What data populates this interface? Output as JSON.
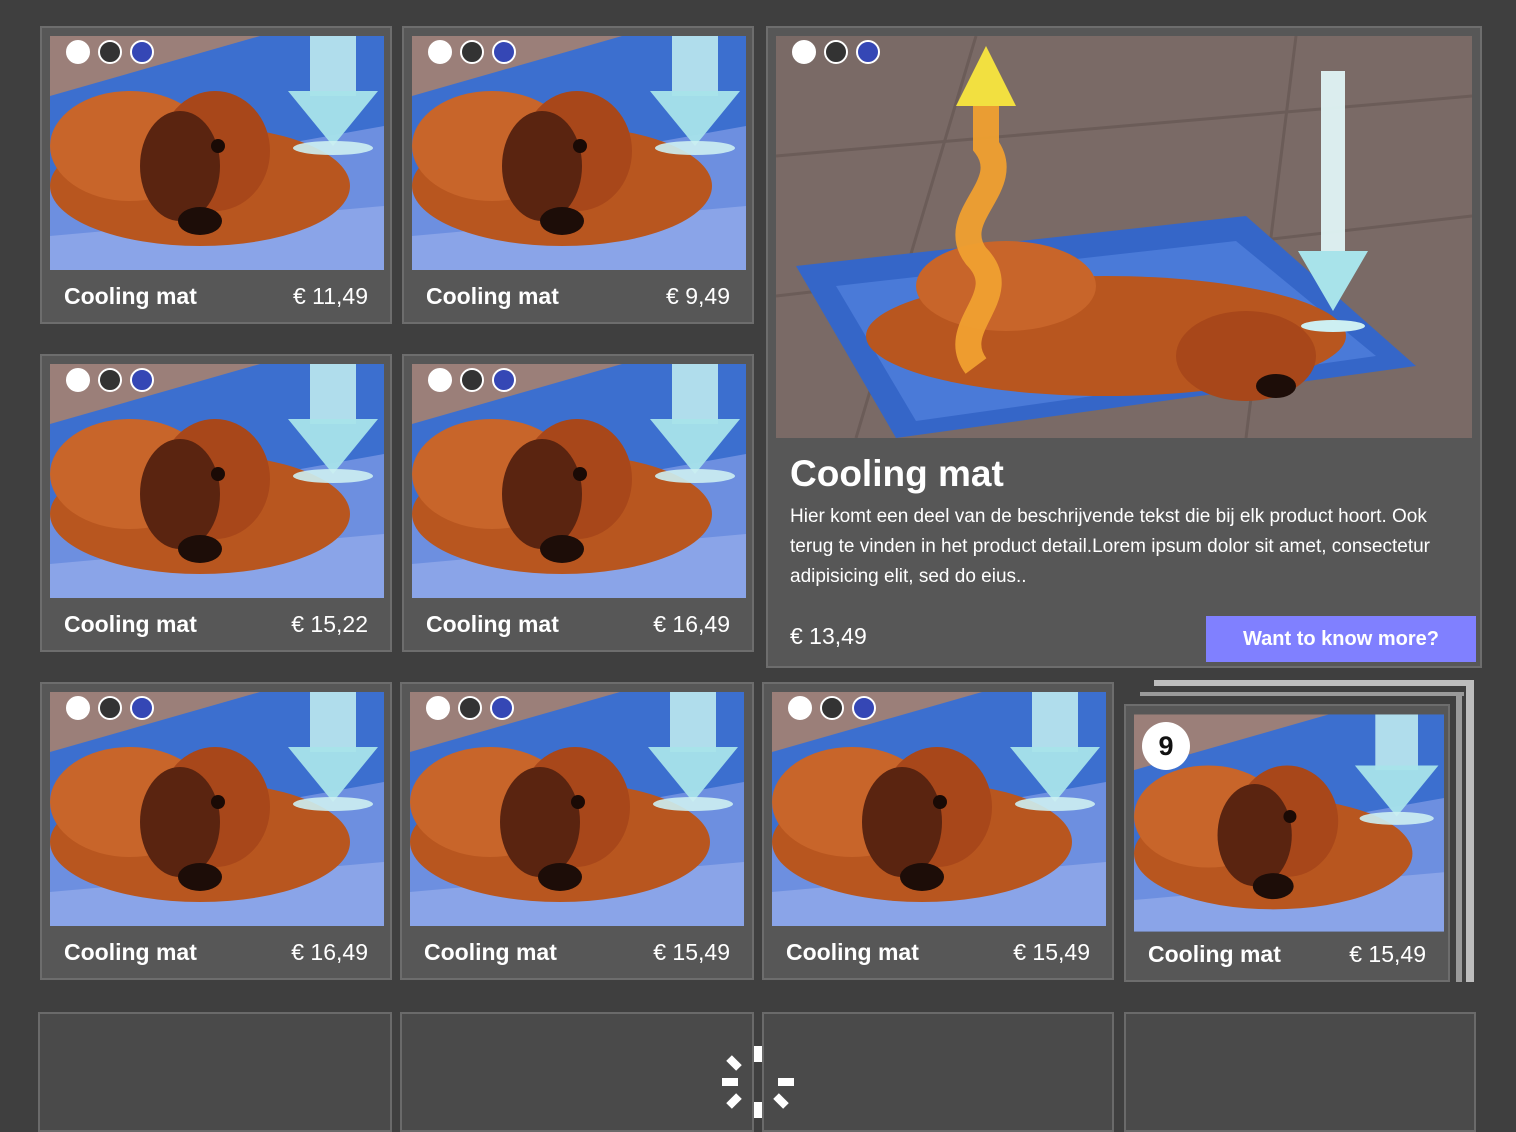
{
  "swatch_colors": [
    "#ffffff",
    "#333333",
    "#3547b5"
  ],
  "accent_color": "#8080ff",
  "products": [
    {
      "name": "Cooling mat",
      "price": "€ 11,49"
    },
    {
      "name": "Cooling mat",
      "price": "€ 9,49"
    },
    {
      "name": "Cooling mat",
      "price": "€ 15,22"
    },
    {
      "name": "Cooling mat",
      "price": "€ 16,49"
    },
    {
      "name": "Cooling mat",
      "price": "€ 16,49"
    },
    {
      "name": "Cooling mat",
      "price": "€ 15,49"
    },
    {
      "name": "Cooling mat",
      "price": "€ 15,49"
    }
  ],
  "featured": {
    "title": "Cooling mat",
    "description": "Hier komt een deel van de beschrijvende tekst die bij elk product hoort. Ook terug te vinden in het product detail.Lorem ipsum dolor sit amet, consectetur adipisicing elit, sed do eius..",
    "price": "€ 13,49",
    "button_label": "Want to know more?"
  },
  "stack": {
    "count_badge": "9",
    "name": "Cooling mat",
    "price": "€ 15,49"
  },
  "loading_icon": "spinner-icon"
}
